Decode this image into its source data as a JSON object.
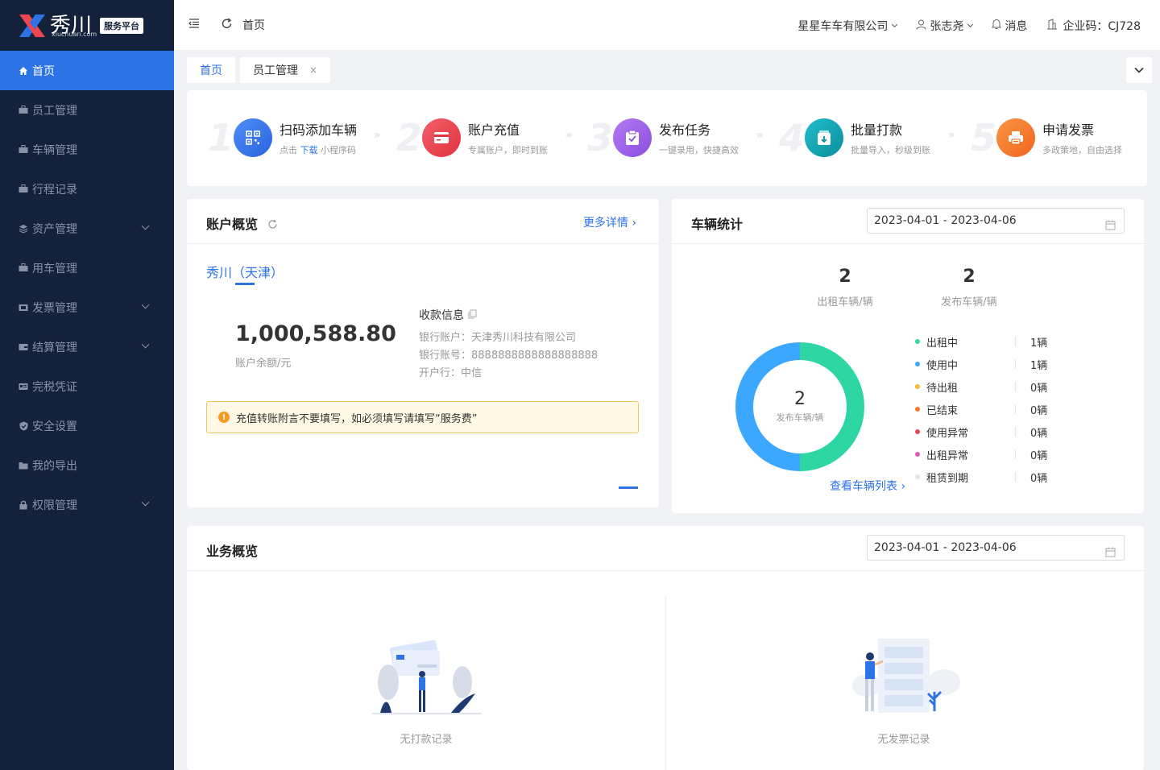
{
  "brand": {
    "name": "秀川",
    "sub": "xiuchuan.com",
    "badge": "服务平台"
  },
  "sidebar": {
    "items": [
      {
        "label": "首页",
        "active": true,
        "expandable": false
      },
      {
        "label": "员工管理",
        "expandable": false
      },
      {
        "label": "车辆管理",
        "expandable": false
      },
      {
        "label": "行程记录",
        "expandable": false
      },
      {
        "label": "资产管理",
        "expandable": true
      },
      {
        "label": "用车管理",
        "expandable": false
      },
      {
        "label": "发票管理",
        "expandable": true
      },
      {
        "label": "结算管理",
        "expandable": true
      },
      {
        "label": "完税凭证",
        "expandable": false
      },
      {
        "label": "安全设置",
        "expandable": false
      },
      {
        "label": "我的导出",
        "expandable": false
      },
      {
        "label": "权限管理",
        "expandable": true
      }
    ]
  },
  "header": {
    "breadcrumb": "首页",
    "company": "星星车车有限公司",
    "user": "张志尧",
    "messages": "消息",
    "enterprise_code": "企业码：CJ728"
  },
  "tabs": [
    {
      "label": "首页",
      "active": true
    },
    {
      "label": "员工管理",
      "closable": true,
      "close": "×"
    }
  ],
  "steps": [
    {
      "num": "1",
      "title": "扫码添加车辆",
      "sub_pre": "点击 ",
      "sub_link": "下载",
      "sub_post": " 小程序码",
      "color": "#2c73e6",
      "icon": "qr-code-icon"
    },
    {
      "num": "2",
      "title": "账户充值",
      "sub": "专属账户，即时到账",
      "color": "#ec4653",
      "icon": "wallet-icon"
    },
    {
      "num": "3",
      "title": "发布任务",
      "sub": "一键录用，快捷高效",
      "color": "#9b5de5",
      "icon": "task-icon"
    },
    {
      "num": "4",
      "title": "批量打款",
      "sub": "批量导入，秒级到账",
      "color": "#12a5b5",
      "icon": "download-box-icon"
    },
    {
      "num": "5",
      "title": "申请发票",
      "sub": "多政策地，自由选择",
      "color": "#f5792b",
      "icon": "printer-icon"
    }
  ],
  "account": {
    "title": "账户概览",
    "more": "更多详情",
    "org": "秀川（天津）",
    "balance": "1,000,588.80",
    "balance_label": "账户余额/元",
    "info_title": "收款信息",
    "bank_account_name": "银行账户：天津秀川科技有限公司",
    "bank_account_no": "银行账号：8888888888888888888",
    "bank": "开户行：中信",
    "notice": "充值转账附言不要填写，如必须填写请填写“服务费”"
  },
  "vehicle": {
    "title": "车辆统计",
    "date_range": "2023-04-01 - 2023-04-06",
    "rented": "2",
    "rented_label": "出租车辆/辆",
    "published": "2",
    "published_label": "发布车辆/辆",
    "center_value": "2",
    "center_label": "发布车辆/辆",
    "link": "查看车辆列表",
    "legend": [
      {
        "name": "出租中",
        "value": "1辆",
        "color": "#2ed6a4"
      },
      {
        "name": "使用中",
        "value": "1辆",
        "color": "#3ca7ff"
      },
      {
        "name": "待出租",
        "value": "0辆",
        "color": "#f5b82e"
      },
      {
        "name": "已结束",
        "value": "0辆",
        "color": "#f5792b"
      },
      {
        "name": "使用异常",
        "value": "0辆",
        "color": "#ec4653"
      },
      {
        "name": "出租异常",
        "value": "0辆",
        "color": "#e05ab8"
      },
      {
        "name": "租赁到期",
        "value": "0辆",
        "color": "#dfe2e8"
      }
    ],
    "chart_data": {
      "type": "pie",
      "categories": [
        "出租中",
        "使用中",
        "待出租",
        "已结束",
        "使用异常",
        "出租异常",
        "租赁到期"
      ],
      "values": [
        1,
        1,
        0,
        0,
        0,
        0,
        0
      ]
    }
  },
  "business": {
    "title": "业务概览",
    "date_range": "2023-04-01 - 2023-04-06",
    "empty_payments": "无打款记录",
    "empty_invoices": "无发票记录"
  }
}
